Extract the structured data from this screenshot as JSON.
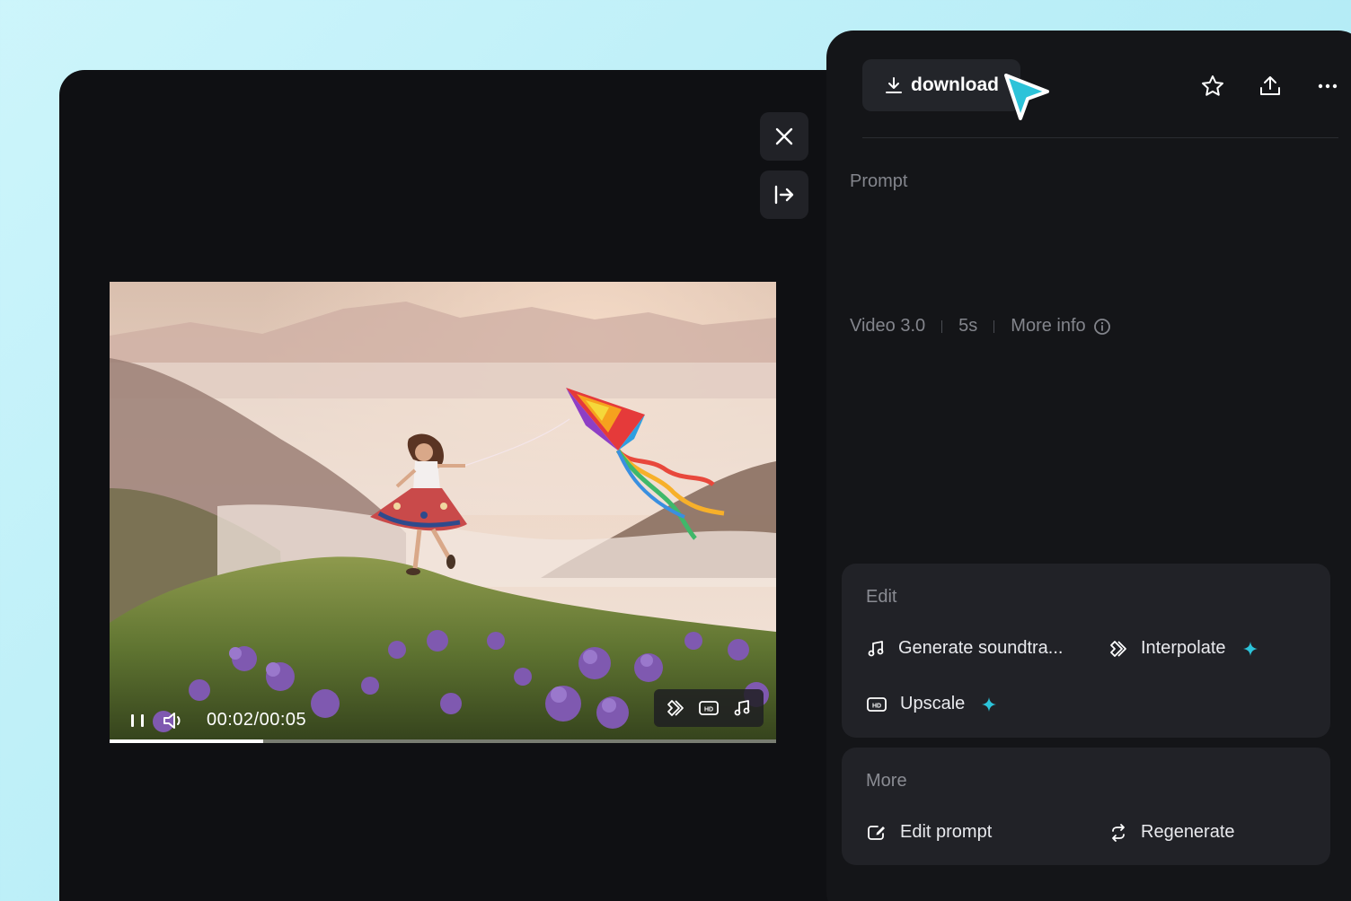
{
  "player": {
    "time": "00:02/00:05",
    "progress_fraction": 0.23
  },
  "panel": {
    "download_label": "download",
    "prompt_label": "Prompt",
    "meta": {
      "model": "Video 3.0",
      "duration": "5s",
      "more_info": "More info"
    },
    "edit_section": {
      "title": "Edit",
      "actions": [
        {
          "label": "Generate soundtra...",
          "icon": "music-note-icon"
        },
        {
          "label": "Interpolate",
          "icon": "interpolate-icon",
          "premium": true
        },
        {
          "label": "Upscale",
          "icon": "hd-icon",
          "premium": true
        }
      ]
    },
    "more_section": {
      "title": "More",
      "actions": [
        {
          "label": "Edit prompt",
          "icon": "edit-prompt-icon"
        },
        {
          "label": "Regenerate",
          "icon": "regenerate-icon"
        }
      ]
    }
  },
  "colors": {
    "accent": "#2cc3d9",
    "window_bg": "#0f1013",
    "panel_bg": "#141518",
    "card_bg": "#212227"
  }
}
